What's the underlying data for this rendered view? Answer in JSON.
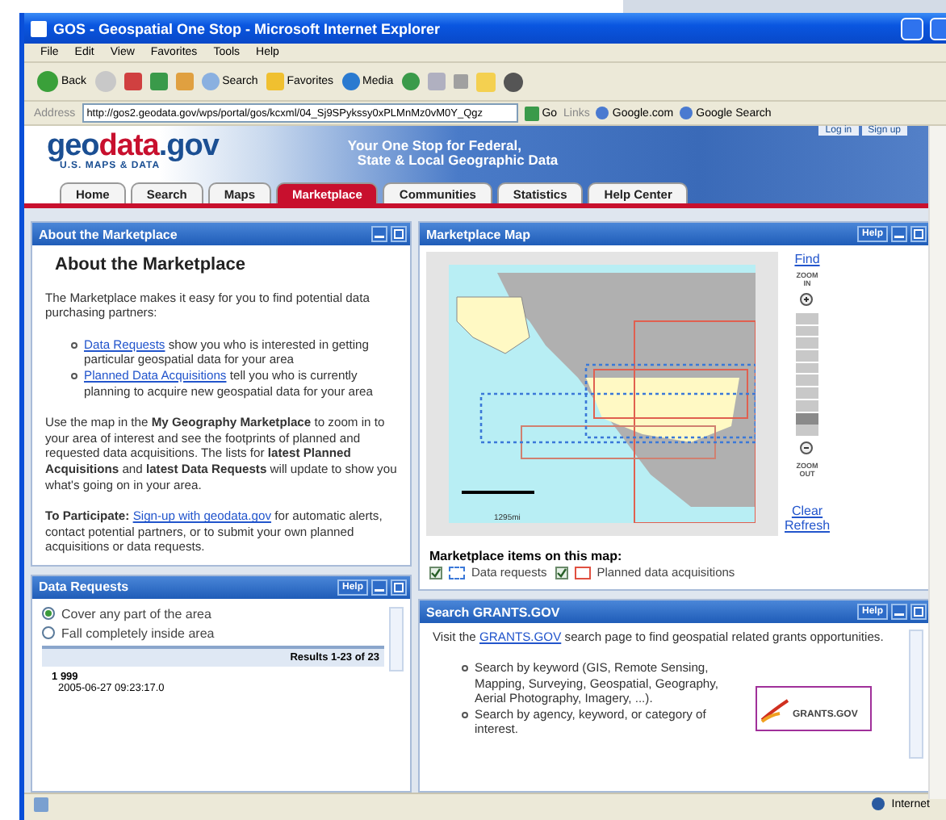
{
  "window": {
    "title": "GOS - Geospatial One Stop - Microsoft Internet Explorer"
  },
  "menu": [
    "File",
    "Edit",
    "View",
    "Favorites",
    "Tools",
    "Help"
  ],
  "toolbar": {
    "back": "Back",
    "search": "Search",
    "favorites": "Favorites",
    "media": "Media"
  },
  "address_bar": {
    "label": "Address",
    "value": "http://gos2.geodata.gov/wps/portal/gos/kcxml/04_Sj9SPykssy0xPLMnMz0vM0Y_Qgz",
    "go": "Go",
    "links_label": "Links",
    "links": [
      "Google.com",
      "Google Search"
    ]
  },
  "banner": {
    "logo": [
      "geo",
      "data",
      ".gov"
    ],
    "logo_subtitle": "U.S. MAPS & DATA",
    "tagline": [
      "Your One Stop for Federal,",
      "State & Local Geographic Data"
    ],
    "account_links": [
      "Log in",
      "Sign up"
    ]
  },
  "tabs": [
    {
      "label": "Home",
      "selected": false
    },
    {
      "label": "Search",
      "selected": false
    },
    {
      "label": "Maps",
      "selected": false
    },
    {
      "label": "Marketplace",
      "selected": true
    },
    {
      "label": "Communities",
      "selected": false
    },
    {
      "label": "Statistics",
      "selected": false
    },
    {
      "label": "Help Center",
      "selected": false
    }
  ],
  "about_panel": {
    "title": "About the Marketplace",
    "heading": "About the Marketplace",
    "intro": "The Marketplace makes it easy for you to find potential data purchasing partners:",
    "bullets": [
      {
        "link": "Data Requests",
        "text": "show you who is interested in getting particular geospatial data for your area"
      },
      {
        "link": "Planned Data Acquisitions",
        "text": "tell you who is currently planning to acquire new geospatial data for your area"
      }
    ],
    "body": "Use the map in the **My Geography Marketplace** to zoom in to your area of interest and see the footprints of planned and requested data acquisitions. The lists for **latest Planned Acquisitions** and **latest Data Requests** will update to show you what's going on in your area.",
    "participate": {
      "label": "To Participate:",
      "link": "Sign-up with geodata.gov",
      "text": "for automatic alerts, contact potential partners, or to submit your own planned acquisitions or data requests."
    }
  },
  "data_requests_panel": {
    "title": "Data Requests",
    "help": "Help",
    "options": [
      {
        "label": "Cover any part of the area",
        "selected": true
      },
      {
        "label": "Fall completely inside area",
        "selected": false
      }
    ],
    "results": "Results 1-23 of 23",
    "items": [
      {
        "number": "1",
        "name": "999",
        "date": "2005-06-27 09:23:17.0"
      }
    ]
  },
  "map_panel": {
    "title": "Marketplace Map",
    "help": "Help",
    "find": "Find",
    "zoom_in": "ZOOM IN",
    "zoom_out": "ZOOM OUT",
    "zoom": {
      "level": 0.1
    },
    "scale": "1295mi",
    "clear": "Clear",
    "refresh": "Refresh",
    "legend_title": "Marketplace items on this map:",
    "legend": [
      {
        "label": "Data requests",
        "checked": true,
        "color": "#3a78d8"
      },
      {
        "label": "Planned data acquisitions",
        "checked": true,
        "color": "#e05040"
      }
    ]
  },
  "grants_panel": {
    "title": "Search GRANTS.GOV",
    "help": "Help",
    "intro_before": "Visit the",
    "intro_link": "GRANTS.GOV",
    "intro_after": "search page to find geospatial related grants opportunities.",
    "bullets": [
      "Search by keyword (GIS, Remote Sensing, Mapping, Surveying, Geospatial, Geography, Aerial Photography, Imagery, ...).",
      "Search by agency, keyword, or category of interest."
    ],
    "logo_text": "GRANTS.GOV"
  },
  "status_bar": {
    "zone": "Internet"
  }
}
